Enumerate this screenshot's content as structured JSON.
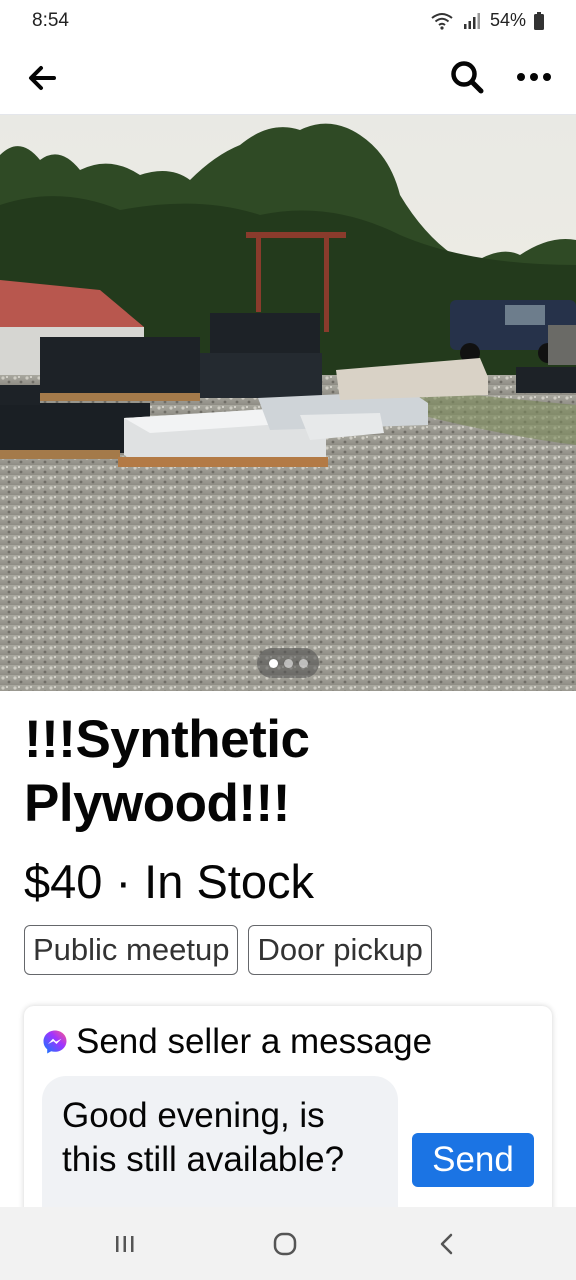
{
  "status": {
    "time": "8:54",
    "battery": "54%"
  },
  "appbar": {
    "icons": [
      "back-arrow-icon",
      "search-icon",
      "more-icon"
    ]
  },
  "photo": {
    "page_count": 3,
    "current_page": 1
  },
  "listing": {
    "title": "!!!Synthetic Plywood!!!",
    "price_line": "$40 · In Stock",
    "tags": [
      "Public meetup",
      "Door pickup"
    ]
  },
  "message": {
    "header": "Send seller a message",
    "draft": "Good evening, is this still available?",
    "send_label": "Send"
  },
  "colors": {
    "accent": "#1b74e4",
    "bubble": "#f0f2f5",
    "navbar": "#f2f2f2"
  }
}
